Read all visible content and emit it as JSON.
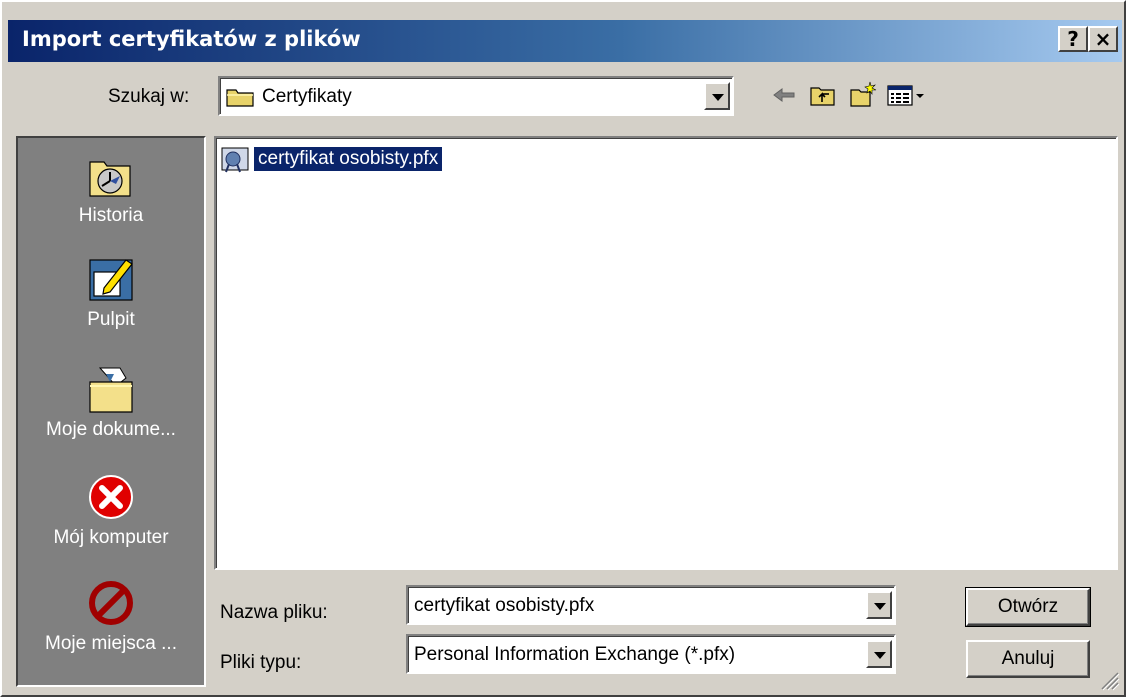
{
  "window": {
    "title": "Import certyfikatów z plików",
    "help_label": "?",
    "close_label": "×"
  },
  "lookin": {
    "label": "Szukaj w:",
    "value": "Certyfikaty"
  },
  "toolbar": {
    "icons": [
      "back-icon",
      "up-folder-icon",
      "new-folder-icon",
      "view-menu-icon"
    ]
  },
  "places": [
    {
      "label": "Historia",
      "icon": "history-icon"
    },
    {
      "label": "Pulpit",
      "icon": "desktop-icon"
    },
    {
      "label": "Moje dokume...",
      "icon": "my-documents-icon"
    },
    {
      "label": "Mój komputer",
      "icon": "my-computer-icon"
    },
    {
      "label": "Moje miejsca ...",
      "icon": "network-places-icon"
    }
  ],
  "files": [
    {
      "name": "certyfikat osobisty.pfx",
      "selected": true,
      "icon": "certificate-file-icon"
    }
  ],
  "filename": {
    "label": "Nazwa pliku:",
    "value": "certyfikat osobisty.pfx"
  },
  "filetype": {
    "label": "Pliki typu:",
    "value": "Personal Information Exchange (*.pfx)"
  },
  "buttons": {
    "open": "Otwórz",
    "cancel": "Anuluj"
  },
  "colors": {
    "title_start": "#0a246a",
    "title_end": "#a6caf0",
    "selection": "#0a246a",
    "face": "#d4d0c8"
  }
}
